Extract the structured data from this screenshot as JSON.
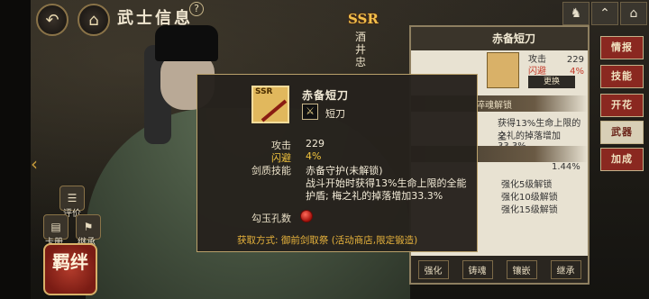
{
  "header": {
    "title": "武士信息",
    "help": "?"
  },
  "character": {
    "rarity": "SSR",
    "name": "酒井忠"
  },
  "side": {
    "review_label": "评价",
    "card_label": "卡册",
    "inherit_label": "继承",
    "seal_text": "羁绊"
  },
  "right_panel": {
    "weapon_name": "赤备短刀",
    "attack_label": "攻击",
    "attack_value": "229",
    "dodge_label": "闪避",
    "dodge_value": "4%",
    "swap_button": "更换",
    "soul_bar": "淬魂解锁",
    "desc_line1": "获得13%生命上限的全",
    "desc_line2": "之礼的掉落增加33.3%",
    "percent": "1.44%",
    "forge_lines": [
      "强化5级解锁",
      "强化10级解锁",
      "强化15级解锁"
    ],
    "bottom_buttons": [
      "强化",
      "铸魂",
      "镶嵌",
      "继承"
    ]
  },
  "tabs": [
    "情报",
    "技能",
    "开花",
    "武器",
    "加成"
  ],
  "active_tab": "武器",
  "tooltip": {
    "rarity": "SSR",
    "name": "赤备短刀",
    "type": "短刀",
    "attack_label": "攻击",
    "attack_value": "229",
    "dodge_label": "闪避",
    "dodge_value": "4%",
    "skill_label": "剑质技能",
    "skill_name": "赤备守护(未解锁)",
    "skill_desc_1": "战斗开始时获得13%生命上限的全能",
    "skill_desc_2": "护盾; 梅之礼的掉落增加33.3%",
    "magatama_label": "勾玉孔数",
    "source": "获取方式: 御前剑取祭 (活动商店,限定锻造)"
  },
  "colors": {
    "accent_gold": "#f2c43e",
    "tab_red": "#8a2820",
    "magatama_red": "#c8231a"
  }
}
